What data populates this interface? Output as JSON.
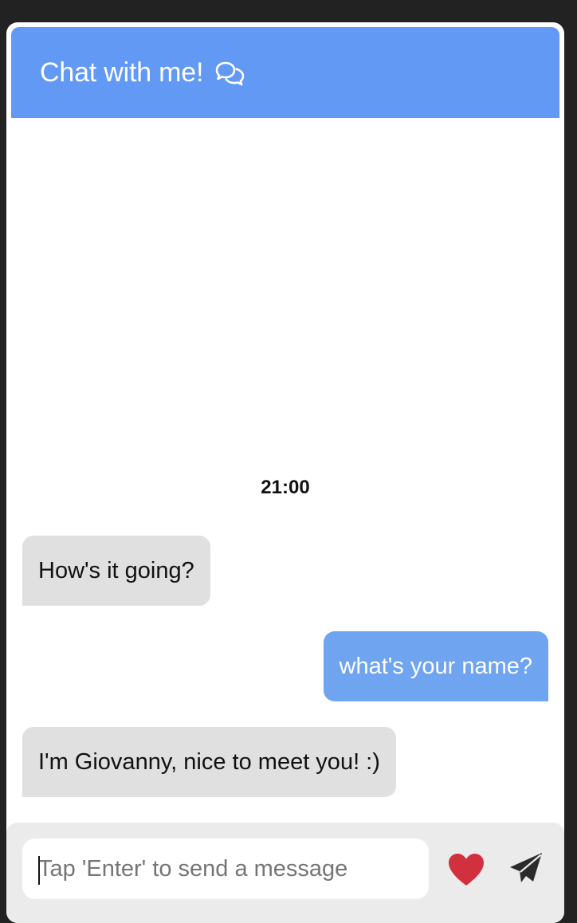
{
  "header": {
    "title": "Chat with me!",
    "icon": "chat-bubbles-icon",
    "background_color": "#6299f5"
  },
  "conversation": {
    "timestamp": "21:00",
    "messages": [
      {
        "sender": "bot",
        "text": "How's it going?"
      },
      {
        "sender": "user",
        "text": "what's your name?"
      },
      {
        "sender": "bot",
        "text": "I'm Giovanny, nice to meet you! :)"
      }
    ],
    "received_color": "#e0e0e0",
    "sent_color": "#6ea4f0"
  },
  "composer": {
    "placeholder": "Tap 'Enter' to send a message",
    "value": "",
    "like_icon": "heart-icon",
    "like_color": "#d1303f",
    "send_icon": "paper-plane-icon"
  }
}
